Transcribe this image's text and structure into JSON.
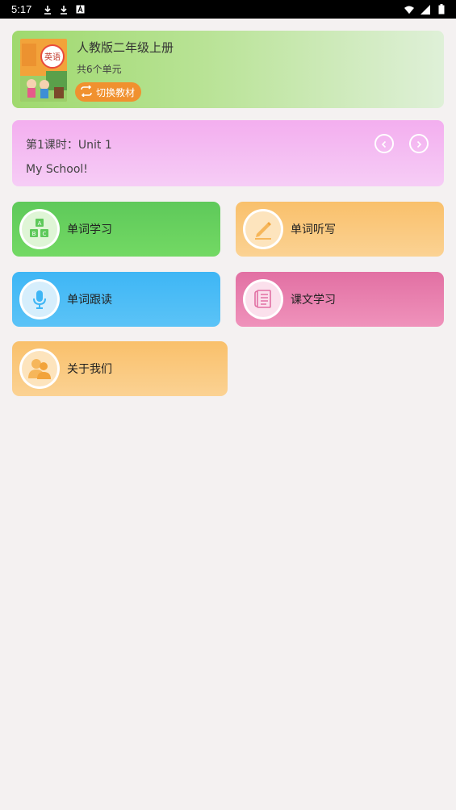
{
  "status_bar": {
    "time": "5:17",
    "left_icons": [
      "download-icon",
      "download-icon",
      "font-icon"
    ],
    "right_icons": [
      "wifi-icon",
      "signal-icon",
      "battery-icon"
    ]
  },
  "book": {
    "cover_label": "英语",
    "title": "人教版二年级上册",
    "units": "共6个单元",
    "switch_label": "切换教材",
    "colors": {
      "card_start": "#9fd96e",
      "card_end": "#dff0d8",
      "switch_bg": "#f0912f"
    }
  },
  "lesson": {
    "title": "第1课时：Unit 1",
    "subtitle": "My School!",
    "colors": {
      "card_start": "#f3aeef",
      "card_end": "#f6cdf6"
    }
  },
  "menu": {
    "vocab_label": "单词学习",
    "dictation_label": "单词听写",
    "read_along_label": "单词跟读",
    "text_study_label": "课文学习",
    "about_label": "关于我们",
    "colors": {
      "green": "#5ec95a",
      "orange": "#f9c06b",
      "blue": "#3eb6f5",
      "pink": "#e270a3"
    }
  }
}
